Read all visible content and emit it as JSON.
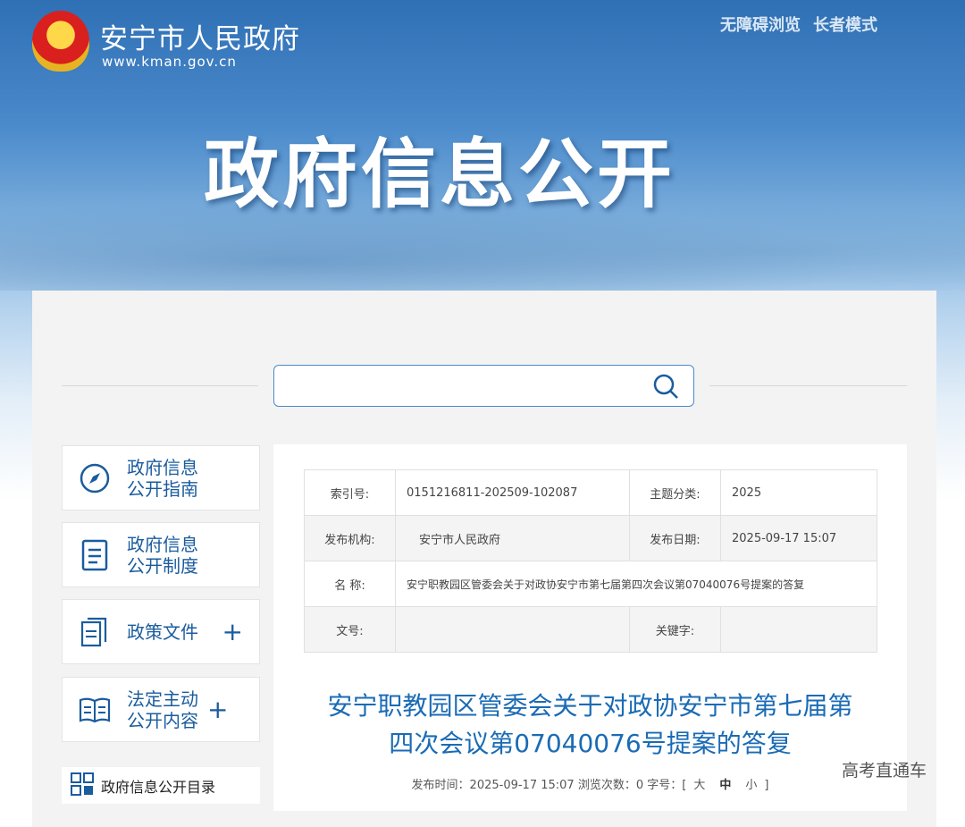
{
  "header": {
    "site_name": "安宁市人民政府",
    "site_url": "www.kman.gov.cn",
    "links": [
      "无障碍浏览",
      "长者模式"
    ],
    "hero": "政府信息公开"
  },
  "search": {
    "placeholder": "",
    "value": ""
  },
  "sidebar": {
    "items": [
      {
        "label": "政府信息公开指南",
        "icon": "compass-icon"
      },
      {
        "label": "政府信息公开制度",
        "icon": "document-icon"
      },
      {
        "label": "政策文件",
        "icon": "files-icon",
        "expandable": true
      },
      {
        "label": "法定主动公开内容",
        "icon": "book-icon",
        "expandable": true
      }
    ],
    "sub_item": "政府信息公开目录",
    "expand_symbol": "+"
  },
  "info_table": {
    "index_label": "索引号:",
    "index_value": "0151216811-202509-102087",
    "topic_label": "主题分类:",
    "topic_value": "2025",
    "org_label": "发布机构:",
    "org_value": "安宁市人民政府",
    "date_label": "发布日期:",
    "date_value": "2025-09-17 15:07",
    "name_label": "名 称:",
    "name_value": "安宁职教园区管委会关于对政协安宁市第七届第四次会议第07040076号提案的答复",
    "docno_label": "文号:",
    "docno_value": "",
    "keyword_label": "关键字:",
    "keyword_value": ""
  },
  "article": {
    "title_line1": "安宁职教园区管委会关于对政协安宁市第七届第",
    "title_line2": "四次会议第07040076号提案的答复",
    "meta_prefix": "发布时间：2025-09-17 15:07 浏览次数：0 字号：[",
    "size_large": "大",
    "size_medium": "中",
    "size_small": "小",
    "meta_suffix": "]"
  },
  "watermark": "高考直通车",
  "colors": {
    "accent": "#1a6bb5",
    "banner": "#3a7bc0"
  }
}
